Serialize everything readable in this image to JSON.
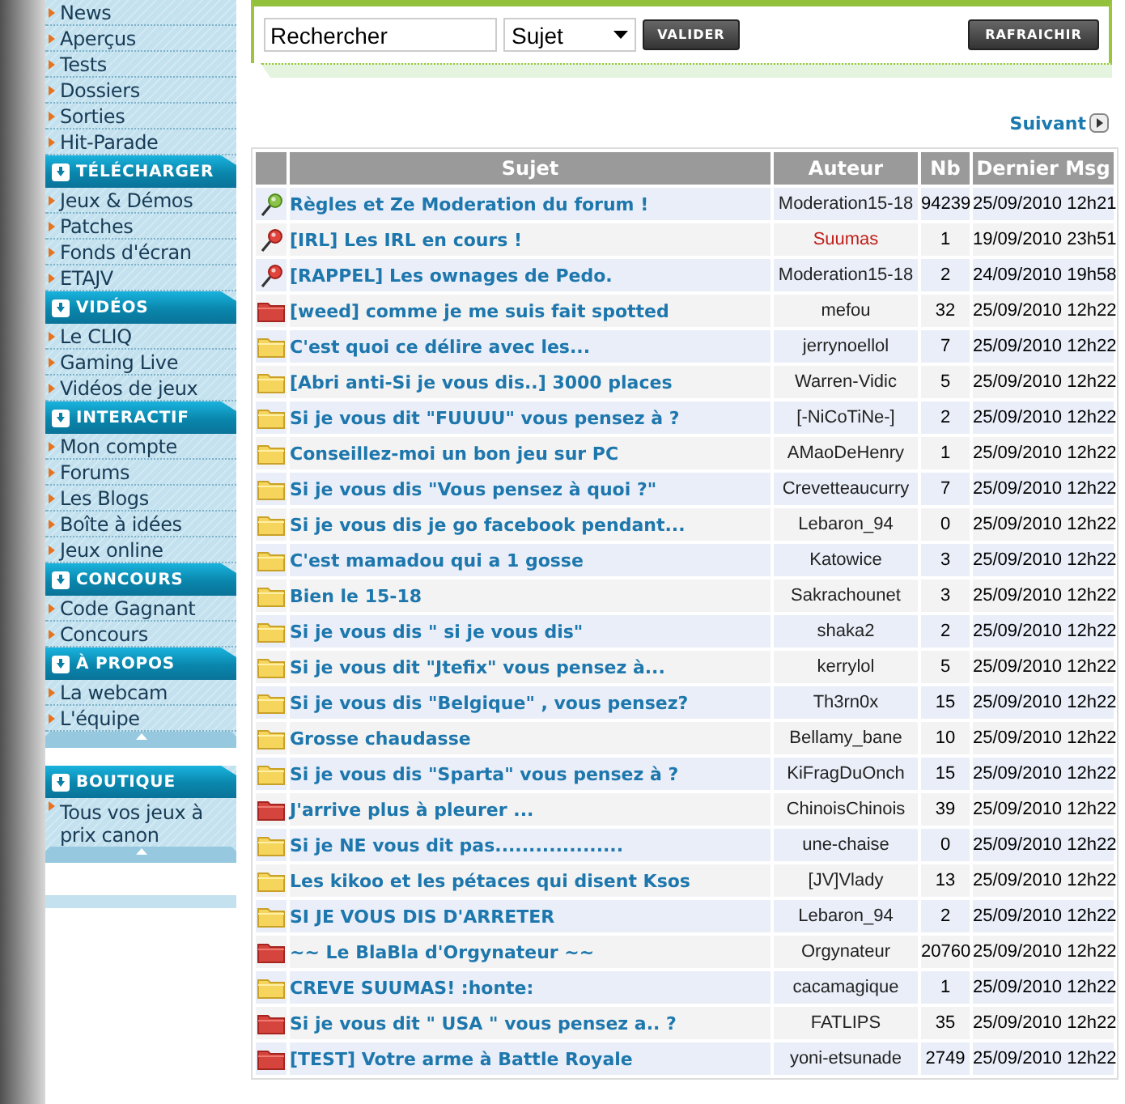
{
  "sidebar": {
    "sections": [
      {
        "items": [
          "News",
          "Aperçus",
          "Tests",
          "Dossiers",
          "Sorties",
          "Hit-Parade"
        ]
      },
      {
        "heading": "TÉLÉCHARGER",
        "items": [
          "Jeux & Démos",
          "Patches",
          "Fonds d'écran",
          "ETAJV"
        ]
      },
      {
        "heading": "VIDÉOS",
        "items": [
          "Le CLIQ",
          "Gaming Live",
          "Vidéos de jeux"
        ]
      },
      {
        "heading": "INTERACTIF",
        "items": [
          "Mon compte",
          "Forums",
          "Les Blogs",
          "Boîte à idées",
          "Jeux online"
        ]
      },
      {
        "heading": "CONCOURS",
        "items": [
          "Code Gagnant",
          "Concours"
        ]
      },
      {
        "heading": "À PROPOS",
        "items": [
          "La webcam",
          "L'équipe"
        ]
      }
    ],
    "shop": {
      "heading": "BOUTIQUE",
      "items": [
        "Tous vos jeux à prix canon"
      ]
    }
  },
  "search": {
    "value": "Rechercher",
    "scope": "Sujet",
    "submit": "VALIDER",
    "refresh": "RAFRAICHIR"
  },
  "pager": {
    "next": "Suivant"
  },
  "table": {
    "columns": [
      "Sujet",
      "Auteur",
      "Nb",
      "Dernier Msg"
    ],
    "rows": [
      {
        "kind": "pinned-open",
        "subject": "Règles et Ze Moderation du forum !",
        "author": "Moderation15-18",
        "author_highlighted": false,
        "count": "94239",
        "last": "25/09/2010 12h21"
      },
      {
        "kind": "pinned-locked",
        "subject": "[IRL] Les IRL en cours !",
        "author": "Suumas",
        "author_highlighted": true,
        "count": "1",
        "last": "19/09/2010 23h51"
      },
      {
        "kind": "pinned-locked",
        "subject": "[RAPPEL] Les ownages de Pedo.",
        "author": "Moderation15-18",
        "author_highlighted": false,
        "count": "2",
        "last": "24/09/2010 19h58"
      },
      {
        "kind": "hot",
        "subject": "[weed] comme je me suis fait spotted",
        "author": "mefou",
        "author_highlighted": false,
        "count": "32",
        "last": "25/09/2010 12h22"
      },
      {
        "kind": "normal",
        "subject": "C'est quoi ce délire avec les...",
        "author": "jerrynoellol",
        "author_highlighted": false,
        "count": "7",
        "last": "25/09/2010 12h22"
      },
      {
        "kind": "normal",
        "subject": "[Abri anti-Si je vous dis..] 3000 places",
        "author": "Warren-Vidic",
        "author_highlighted": false,
        "count": "5",
        "last": "25/09/2010 12h22"
      },
      {
        "kind": "normal",
        "subject": "Si je vous dit \"FUUUU\" vous pensez à ?",
        "author": "[-NiCoTiNe-]",
        "author_highlighted": false,
        "count": "2",
        "last": "25/09/2010 12h22"
      },
      {
        "kind": "normal",
        "subject": "Conseillez-moi un bon jeu sur PC",
        "author": "AMaoDeHenry",
        "author_highlighted": false,
        "count": "1",
        "last": "25/09/2010 12h22"
      },
      {
        "kind": "normal",
        "subject": "Si je vous dis \"Vous pensez à quoi ?\"",
        "author": "Crevetteaucurry",
        "author_highlighted": false,
        "count": "7",
        "last": "25/09/2010 12h22"
      },
      {
        "kind": "normal",
        "subject": "Si je vous dis je go facebook pendant...",
        "author": "Lebaron_94",
        "author_highlighted": false,
        "count": "0",
        "last": "25/09/2010 12h22"
      },
      {
        "kind": "normal",
        "subject": "C'est mamadou qui a 1 gosse",
        "author": "Katowice",
        "author_highlighted": false,
        "count": "3",
        "last": "25/09/2010 12h22"
      },
      {
        "kind": "normal",
        "subject": "Bien le 15-18",
        "author": "Sakrachounet",
        "author_highlighted": false,
        "count": "3",
        "last": "25/09/2010 12h22"
      },
      {
        "kind": "normal",
        "subject": "Si je vous dis \" si je vous dis\"",
        "author": "shaka2",
        "author_highlighted": false,
        "count": "2",
        "last": "25/09/2010 12h22"
      },
      {
        "kind": "normal",
        "subject": "Si je vous dit \"Jtefix\" vous pensez à...",
        "author": "kerrylol",
        "author_highlighted": false,
        "count": "5",
        "last": "25/09/2010 12h22"
      },
      {
        "kind": "normal",
        "subject": "Si je vous dis \"Belgique\" , vous pensez?",
        "author": "Th3rn0x",
        "author_highlighted": false,
        "count": "15",
        "last": "25/09/2010 12h22"
      },
      {
        "kind": "normal",
        "subject": "Grosse chaudasse",
        "author": "Bellamy_bane",
        "author_highlighted": false,
        "count": "10",
        "last": "25/09/2010 12h22"
      },
      {
        "kind": "normal",
        "subject": "Si je vous dis \"Sparta\" vous pensez à ?",
        "author": "KiFragDuOnch",
        "author_highlighted": false,
        "count": "15",
        "last": "25/09/2010 12h22"
      },
      {
        "kind": "hot",
        "subject": "J'arrive plus à pleurer ...",
        "author": "ChinoisChinois",
        "author_highlighted": false,
        "count": "39",
        "last": "25/09/2010 12h22"
      },
      {
        "kind": "normal",
        "subject": "Si je NE vous dit pas...................",
        "author": "une-chaise",
        "author_highlighted": false,
        "count": "0",
        "last": "25/09/2010 12h22"
      },
      {
        "kind": "normal",
        "subject": "Les kikoo et les pétaces qui disent Ksos",
        "author": "[JV]Vlady",
        "author_highlighted": false,
        "count": "13",
        "last": "25/09/2010 12h22"
      },
      {
        "kind": "normal",
        "subject": "SI JE VOUS DIS D'ARRETER",
        "author": "Lebaron_94",
        "author_highlighted": false,
        "count": "2",
        "last": "25/09/2010 12h22"
      },
      {
        "kind": "hot",
        "subject": "~~ Le BlaBla d'Orgynateur ~~",
        "author": "Orgynateur",
        "author_highlighted": false,
        "count": "20760",
        "last": "25/09/2010 12h22"
      },
      {
        "kind": "normal",
        "subject": "CREVE SUUMAS! :honte:",
        "author": "cacamagique",
        "author_highlighted": false,
        "count": "1",
        "last": "25/09/2010 12h22"
      },
      {
        "kind": "hot",
        "subject": "Si je vous dit \" USA \" vous pensez a.. ?",
        "author": "FATLIPS",
        "author_highlighted": false,
        "count": "35",
        "last": "25/09/2010 12h22"
      },
      {
        "kind": "hot",
        "subject": "[TEST] Votre arme à Battle Royale",
        "author": "yoni-etsunade",
        "author_highlighted": false,
        "count": "2749",
        "last": "25/09/2010 12h22"
      }
    ]
  }
}
